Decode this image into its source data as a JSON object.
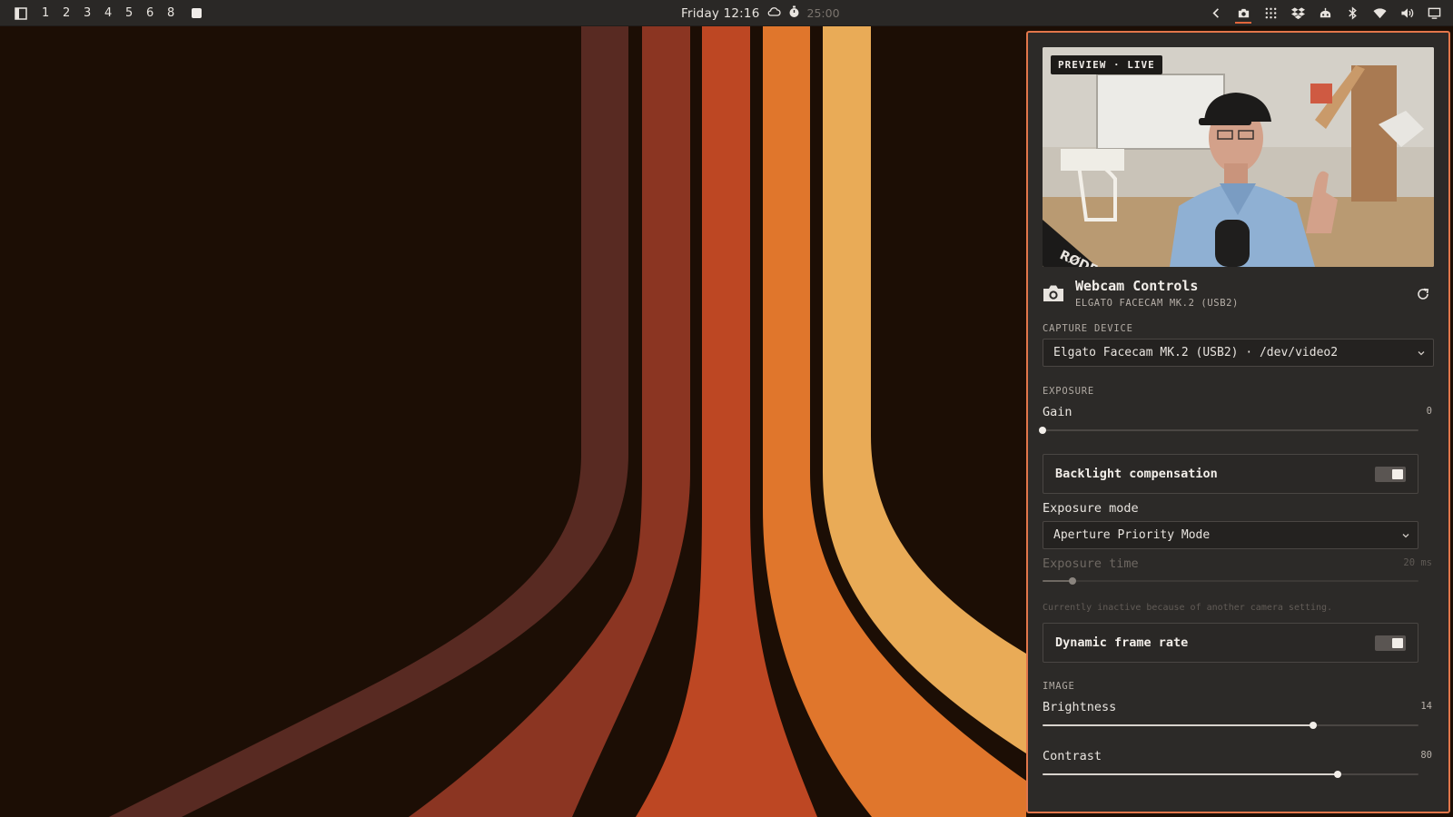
{
  "topbar": {
    "workspaces": [
      "1",
      "2",
      "3",
      "4",
      "5",
      "6",
      "8"
    ],
    "clock": "Friday 12:16",
    "timer": "25:00",
    "tray_icons": [
      "chevron-left-icon",
      "camera-icon",
      "grid-icon",
      "dropbox-icon",
      "robot-icon",
      "bluetooth-icon",
      "wifi-icon",
      "volume-icon",
      "monitor-icon"
    ]
  },
  "colors": {
    "accent": "#e2764a",
    "panel_bg": "#2c2a28",
    "wallpaper_bg": "#1c0e05",
    "stripe_1": "#582a22",
    "stripe_2": "#8b3522",
    "stripe_3": "#bd4723",
    "stripe_4": "#e0762c",
    "stripe_5": "#e9ab57"
  },
  "panel": {
    "preview_badge": "PREVIEW · LIVE",
    "title": "Webcam Controls",
    "subtitle": "ELGATO FACECAM MK.2 (USB2)",
    "capture_device": {
      "section_label": "CAPTURE DEVICE",
      "selected": "Elgato Facecam MK.2 (USB2) · /dev/video2"
    },
    "exposure": {
      "section_label": "EXPOSURE",
      "gain": {
        "label": "Gain",
        "value": "0",
        "level": 0.0
      },
      "backlight": {
        "label": "Backlight compensation",
        "on": true
      },
      "mode": {
        "label": "Exposure mode",
        "selected": "Aperture Priority Mode"
      },
      "time": {
        "label": "Exposure time",
        "value": "20 ms",
        "level": 0.08,
        "inactive": true
      },
      "hint": "Currently inactive because of another camera setting.",
      "dynamic_frame_rate": {
        "label": "Dynamic frame rate",
        "on": true
      }
    },
    "image": {
      "section_label": "IMAGE",
      "brightness": {
        "label": "Brightness",
        "value": "14",
        "level": 0.72
      },
      "contrast": {
        "label": "Contrast",
        "value": "80",
        "level": 0.785
      }
    }
  }
}
